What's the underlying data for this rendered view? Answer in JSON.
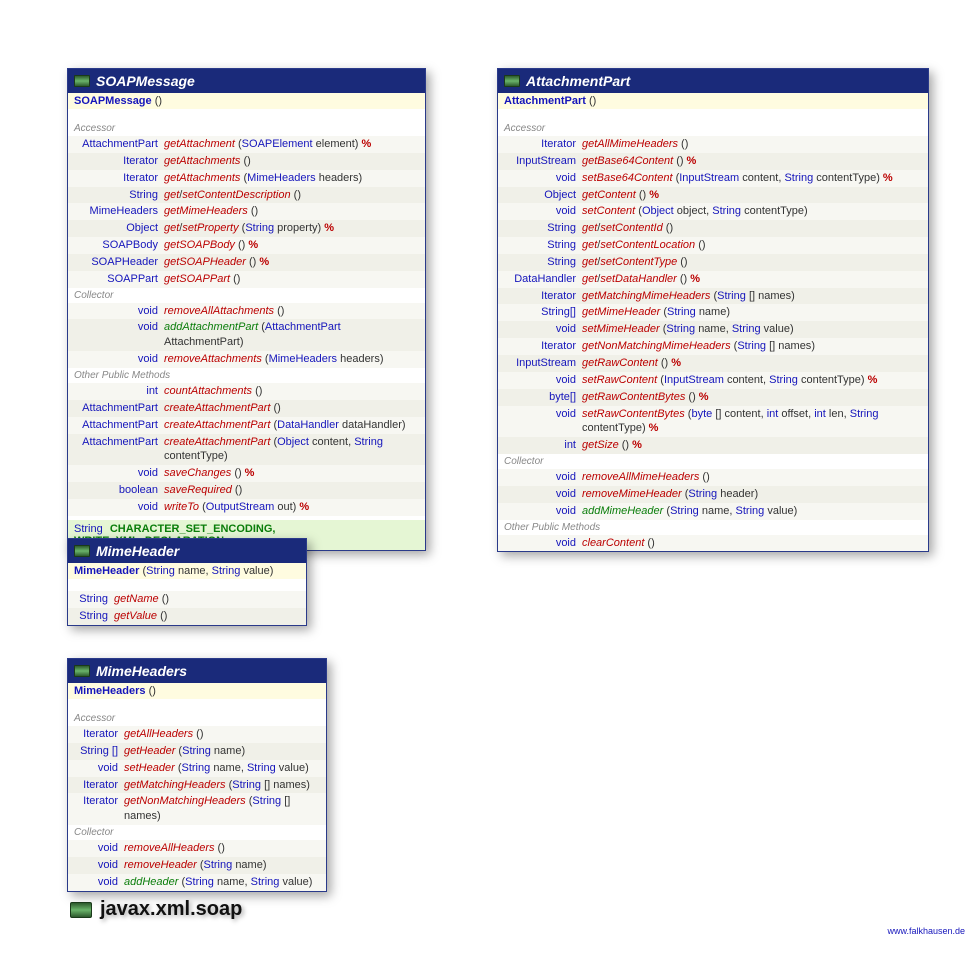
{
  "package_name": "javax.xml.soap",
  "credit": "www.falkhausen.de",
  "classes": {
    "soapMessage": {
      "name": "SOAPMessage",
      "ctor": "SOAPMessage",
      "sections": {
        "accessor": "Accessor",
        "collector": "Collector",
        "other": "Other Public Methods"
      },
      "accessors": [
        {
          "ret": "AttachmentPart",
          "name": "getAttachment",
          "params": [
            {
              "t": "SOAPElement",
              "n": "element"
            }
          ],
          "throws": true
        },
        {
          "ret": "Iterator",
          "name": "getAttachments",
          "params": [],
          "throws": false
        },
        {
          "ret": "Iterator",
          "name": "getAttachments",
          "params": [
            {
              "t": "MimeHeaders",
              "n": "headers"
            }
          ],
          "throws": false
        },
        {
          "ret": "String",
          "name": "get/setContentDescription",
          "params": [],
          "throws": false
        },
        {
          "ret": "MimeHeaders",
          "name": "getMimeHeaders",
          "params": [],
          "throws": false
        },
        {
          "ret": "Object",
          "name": "get/setProperty",
          "params": [
            {
              "t": "String",
              "n": "property"
            }
          ],
          "throws": true
        },
        {
          "ret": "SOAPBody",
          "name": "getSOAPBody",
          "params": [],
          "throws": true
        },
        {
          "ret": "SOAPHeader",
          "name": "getSOAPHeader",
          "params": [],
          "throws": true
        },
        {
          "ret": "SOAPPart",
          "name": "getSOAPPart",
          "params": [],
          "throws": false
        }
      ],
      "collectors": [
        {
          "ret": "void",
          "name": "removeAllAttachments",
          "params": [],
          "throws": false
        },
        {
          "ret": "void",
          "name": "addAttachmentPart",
          "params": [
            {
              "t": "AttachmentPart",
              "n": "AttachmentPart"
            }
          ],
          "throws": false,
          "green": true
        },
        {
          "ret": "void",
          "name": "removeAttachments",
          "params": [
            {
              "t": "MimeHeaders",
              "n": "headers"
            }
          ],
          "throws": false
        }
      ],
      "others": [
        {
          "ret": "int",
          "name": "countAttachments",
          "params": [],
          "throws": false
        },
        {
          "ret": "AttachmentPart",
          "name": "createAttachmentPart",
          "params": [],
          "throws": false
        },
        {
          "ret": "AttachmentPart",
          "name": "createAttachmentPart",
          "params": [
            {
              "t": "DataHandler",
              "n": "dataHandler"
            }
          ],
          "throws": false
        },
        {
          "ret": "AttachmentPart",
          "name": "createAttachmentPart",
          "params": [
            {
              "t": "Object",
              "n": "content"
            },
            {
              "t": "String",
              "n": "contentType"
            }
          ],
          "throws": false
        },
        {
          "ret": "void",
          "name": "saveChanges",
          "params": [],
          "throws": true
        },
        {
          "ret": "boolean",
          "name": "saveRequired",
          "params": [],
          "throws": false
        },
        {
          "ret": "void",
          "name": "writeTo",
          "params": [
            {
              "t": "OutputStream",
              "n": "out"
            }
          ],
          "throws": true
        }
      ],
      "constants_type": "String",
      "constants": "CHARACTER_SET_ENCODING, WRITE_XML_DECLARATION"
    },
    "attachmentPart": {
      "name": "AttachmentPart",
      "ctor": "AttachmentPart",
      "sections": {
        "accessor": "Accessor",
        "collector": "Collector",
        "other": "Other Public Methods"
      },
      "accessors": [
        {
          "ret": "Iterator",
          "name": "getAllMimeHeaders",
          "params": [],
          "throws": false
        },
        {
          "ret": "InputStream",
          "name": "getBase64Content",
          "params": [],
          "throws": true
        },
        {
          "ret": "void",
          "name": "setBase64Content",
          "params": [
            {
              "t": "InputStream",
              "n": "content"
            },
            {
              "t": "String",
              "n": "contentType"
            }
          ],
          "throws": true
        },
        {
          "ret": "Object",
          "name": "getContent",
          "params": [],
          "throws": true
        },
        {
          "ret": "void",
          "name": "setContent",
          "params": [
            {
              "t": "Object",
              "n": "object"
            },
            {
              "t": "String",
              "n": "contentType"
            }
          ],
          "throws": false
        },
        {
          "ret": "String",
          "name": "get/setContentId",
          "params": [],
          "throws": false
        },
        {
          "ret": "String",
          "name": "get/setContentLocation",
          "params": [],
          "throws": false
        },
        {
          "ret": "String",
          "name": "get/setContentType",
          "params": [],
          "throws": false
        },
        {
          "ret": "DataHandler",
          "name": "get/setDataHandler",
          "params": [],
          "throws": true
        },
        {
          "ret": "Iterator",
          "name": "getMatchingMimeHeaders",
          "params": [
            {
              "t": "String",
              "n": "[] names"
            }
          ],
          "throws": false
        },
        {
          "ret": "String[]",
          "name": "getMimeHeader",
          "params": [
            {
              "t": "String",
              "n": "name"
            }
          ],
          "throws": false
        },
        {
          "ret": "void",
          "name": "setMimeHeader",
          "params": [
            {
              "t": "String",
              "n": "name"
            },
            {
              "t": "String",
              "n": "value"
            }
          ],
          "throws": false
        },
        {
          "ret": "Iterator",
          "name": "getNonMatchingMimeHeaders",
          "params": [
            {
              "t": "String",
              "n": "[] names"
            }
          ],
          "throws": false
        },
        {
          "ret": "InputStream",
          "name": "getRawContent",
          "params": [],
          "throws": true
        },
        {
          "ret": "void",
          "name": "setRawContent",
          "params": [
            {
              "t": "InputStream",
              "n": "content"
            },
            {
              "t": "String",
              "n": "contentType"
            }
          ],
          "throws": true
        },
        {
          "ret": "byte[]",
          "name": "getRawContentBytes",
          "params": [],
          "throws": true
        },
        {
          "ret": "void",
          "name": "setRawContentBytes",
          "params": [
            {
              "t": "byte",
              "n": "[] content"
            },
            {
              "t": "int",
              "n": "offset"
            },
            {
              "t": "int",
              "n": "len"
            },
            {
              "t": "String",
              "n": "contentType"
            }
          ],
          "throws": true
        },
        {
          "ret": "int",
          "name": "getSize",
          "params": [],
          "throws": true
        }
      ],
      "collectors": [
        {
          "ret": "void",
          "name": "removeAllMimeHeaders",
          "params": [],
          "throws": false
        },
        {
          "ret": "void",
          "name": "removeMimeHeader",
          "params": [
            {
              "t": "String",
              "n": "header"
            }
          ],
          "throws": false
        },
        {
          "ret": "void",
          "name": "addMimeHeader",
          "params": [
            {
              "t": "String",
              "n": "name"
            },
            {
              "t": "String",
              "n": "value"
            }
          ],
          "throws": false,
          "green": true
        }
      ],
      "others": [
        {
          "ret": "void",
          "name": "clearContent",
          "params": [],
          "throws": false
        }
      ]
    },
    "mimeHeader": {
      "name": "MimeHeader",
      "ctor": "MimeHeader",
      "ctor_params": [
        {
          "t": "String",
          "n": "name"
        },
        {
          "t": "String",
          "n": "value"
        }
      ],
      "methods": [
        {
          "ret": "String",
          "name": "getName",
          "params": [],
          "throws": false
        },
        {
          "ret": "String",
          "name": "getValue",
          "params": [],
          "throws": false
        }
      ]
    },
    "mimeHeaders": {
      "name": "MimeHeaders",
      "ctor": "MimeHeaders",
      "sections": {
        "accessor": "Accessor",
        "collector": "Collector"
      },
      "accessors": [
        {
          "ret": "Iterator",
          "name": "getAllHeaders",
          "params": [],
          "throws": false
        },
        {
          "ret": "String []",
          "name": "getHeader",
          "params": [
            {
              "t": "String",
              "n": "name"
            }
          ],
          "throws": false
        },
        {
          "ret": "void",
          "name": "setHeader",
          "params": [
            {
              "t": "String",
              "n": "name"
            },
            {
              "t": "String",
              "n": "value"
            }
          ],
          "throws": false
        },
        {
          "ret": "Iterator",
          "name": "getMatchingHeaders",
          "params": [
            {
              "t": "String",
              "n": "[] names"
            }
          ],
          "throws": false
        },
        {
          "ret": "Iterator",
          "name": "getNonMatchingHeaders",
          "params": [
            {
              "t": "String",
              "n": "[] names"
            }
          ],
          "throws": false
        }
      ],
      "collectors": [
        {
          "ret": "void",
          "name": "removeAllHeaders",
          "params": [],
          "throws": false
        },
        {
          "ret": "void",
          "name": "removeHeader",
          "params": [
            {
              "t": "String",
              "n": "name"
            }
          ],
          "throws": false
        },
        {
          "ret": "void",
          "name": "addHeader",
          "params": [
            {
              "t": "String",
              "n": "name"
            },
            {
              "t": "String",
              "n": "value"
            }
          ],
          "throws": false,
          "green": true
        }
      ]
    }
  }
}
